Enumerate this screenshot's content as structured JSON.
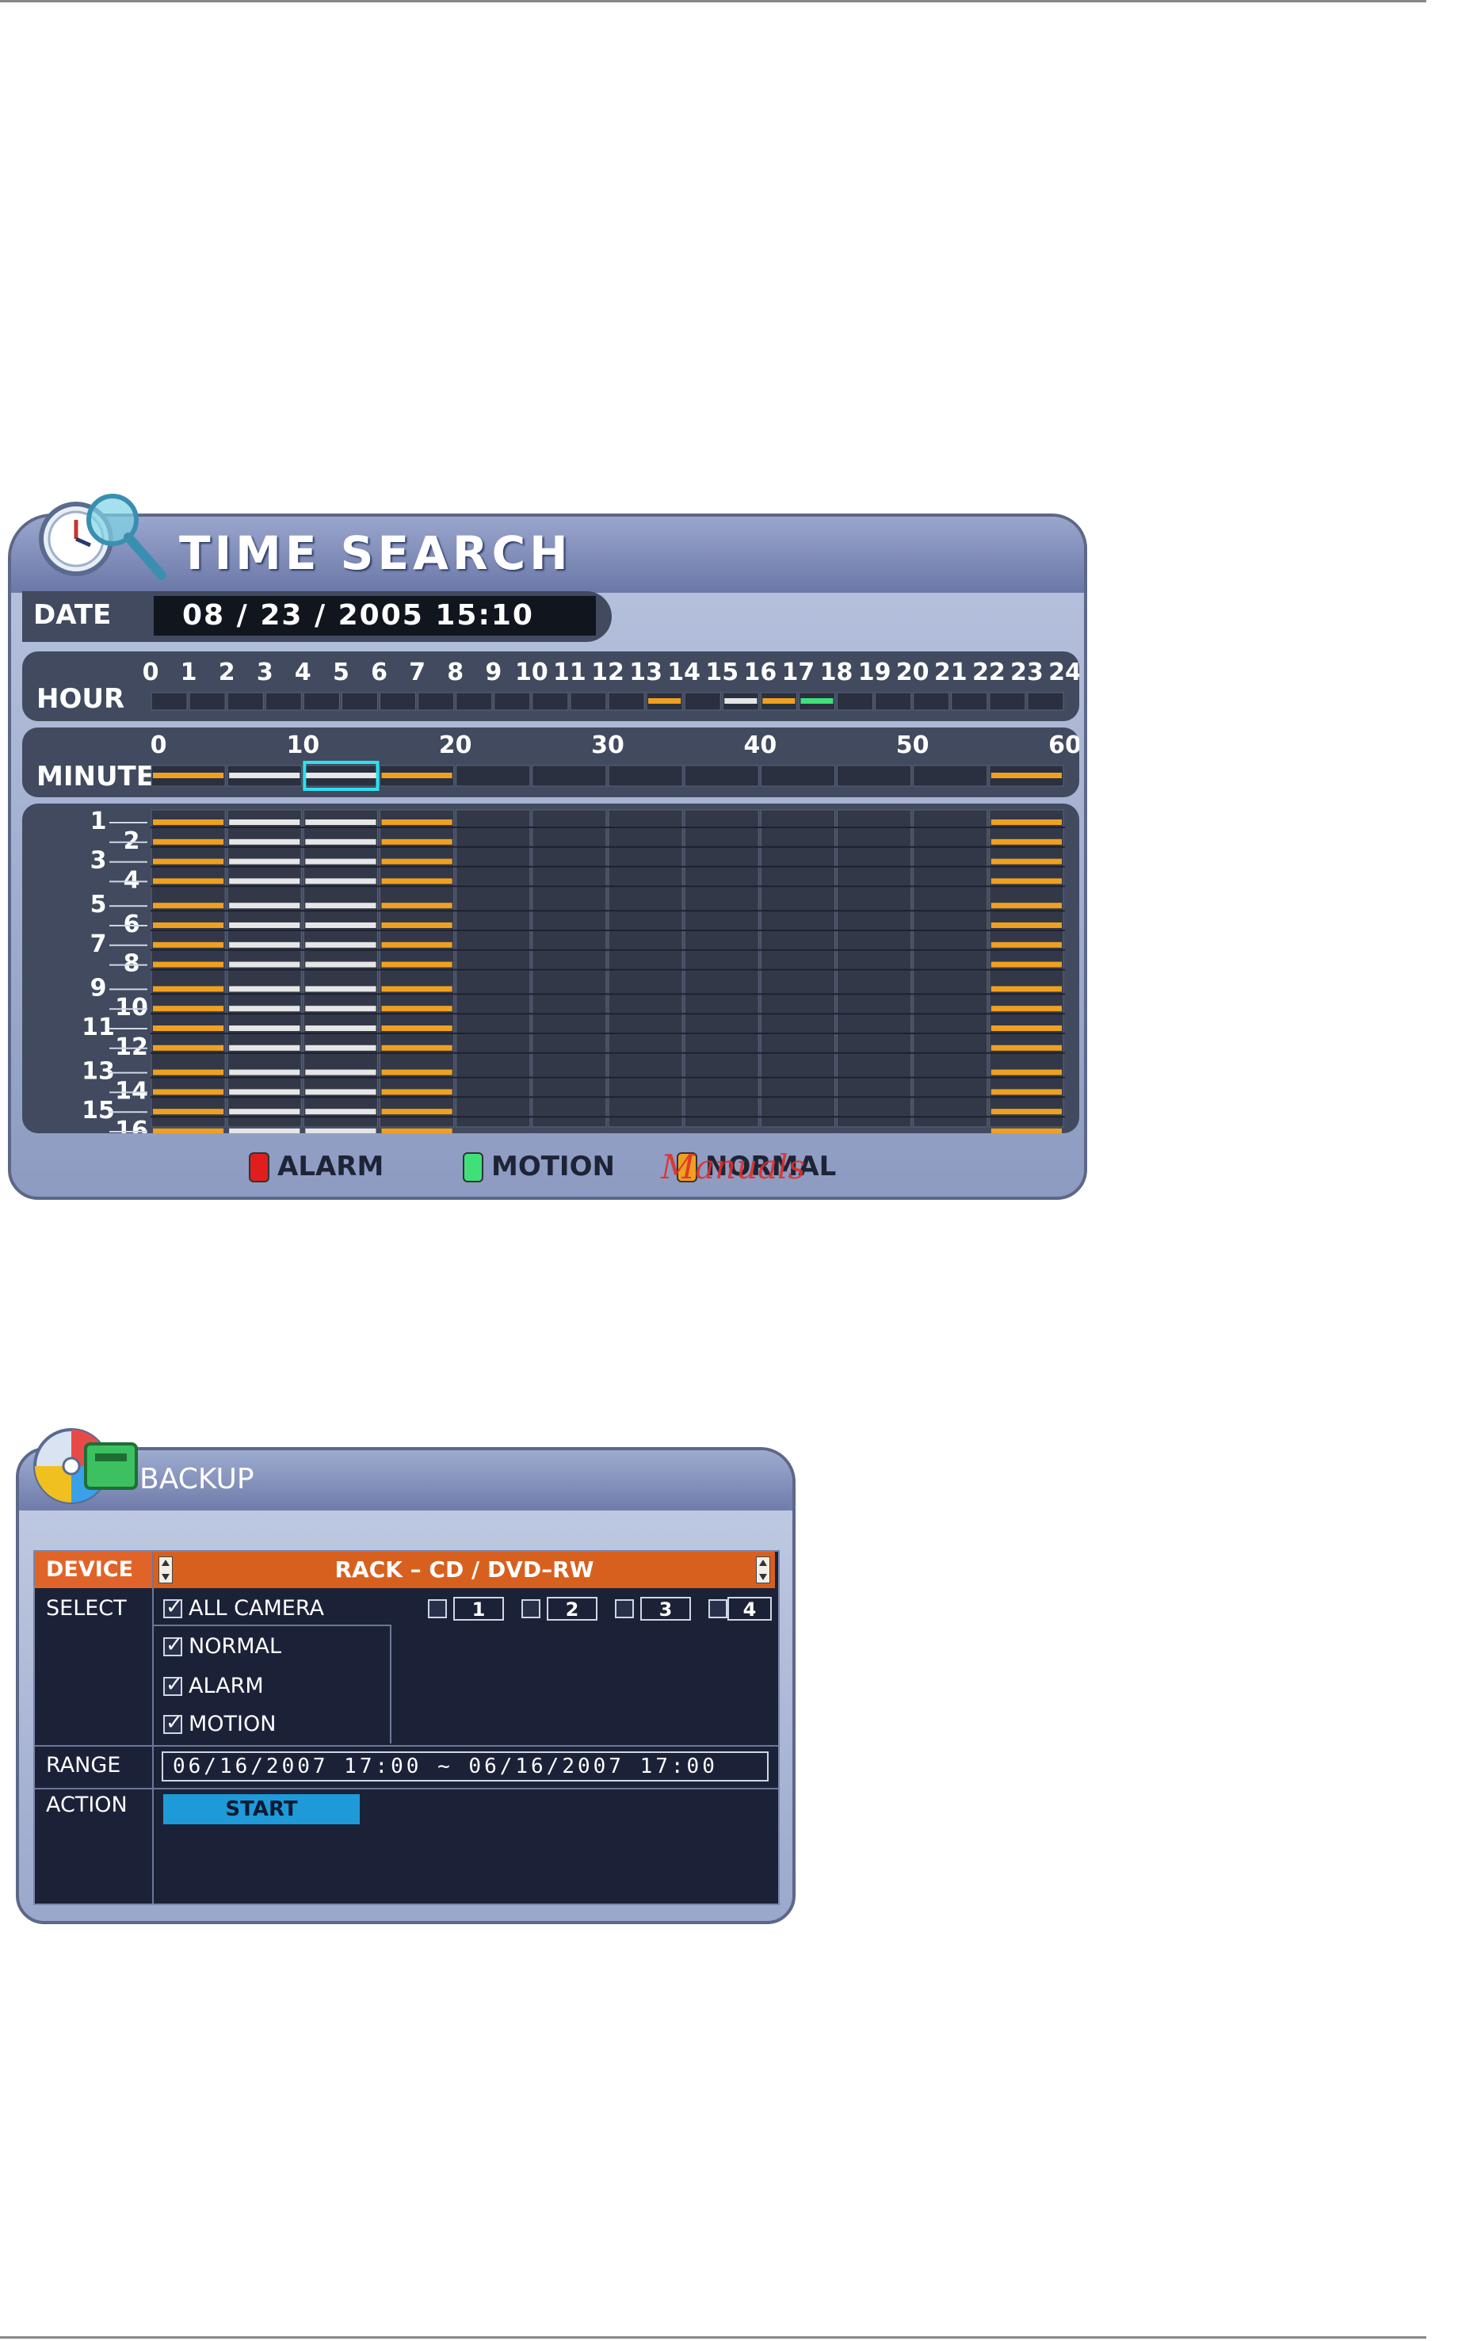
{
  "time_search": {
    "title": "TIME SEARCH",
    "date_label": "DATE",
    "date_value": "08 / 23 / 2005  15:10",
    "hour_label": "HOUR",
    "hour_ticks": [
      "0",
      "1",
      "2",
      "3",
      "4",
      "5",
      "6",
      "7",
      "8",
      "9",
      "10",
      "11",
      "12",
      "13",
      "14",
      "15",
      "16",
      "17",
      "18",
      "19",
      "20",
      "21",
      "22",
      "23",
      "24"
    ],
    "hour_bars": [
      {
        "hour": 13,
        "type": "normal"
      },
      {
        "hour": 15,
        "type": "white"
      },
      {
        "hour": 16,
        "type": "normal"
      },
      {
        "hour": 17,
        "type": "motion"
      }
    ],
    "minute_label": "MINUTE",
    "minute_ticks": [
      "0",
      "10",
      "20",
      "30",
      "40",
      "50",
      "60"
    ],
    "minute_bars": [
      {
        "segment": 0,
        "type": "normal"
      },
      {
        "segment": 1,
        "type": "white"
      },
      {
        "segment": 2,
        "type": "white"
      },
      {
        "segment": 3,
        "type": "normal"
      },
      {
        "segment": 11,
        "type": "normal"
      }
    ],
    "selected_minute_segment": 2,
    "channel_labels": [
      "1",
      "2",
      "3",
      "4",
      "5",
      "6",
      "7",
      "8",
      "9",
      "10",
      "11",
      "12",
      "13",
      "14",
      "15",
      "16"
    ],
    "channel_pattern": [
      "normal",
      "white",
      "white",
      "normal",
      "none",
      "none",
      "none",
      "none",
      "none",
      "none",
      "none",
      "normal"
    ],
    "legend": [
      {
        "label": "ALARM",
        "color": "#e01e1e"
      },
      {
        "label": "MOTION",
        "color": "#3fe07a"
      },
      {
        "label": "NORMAL",
        "color": "#f0a020"
      }
    ],
    "watermark": "Manuals",
    "colors": {
      "normal": "#f0a020",
      "white": "#e6e6e6",
      "motion": "#3fe07a",
      "alarm": "#e01e1e",
      "selected": "#2ee0f0"
    }
  },
  "backup": {
    "title": "BACKUP",
    "device_label": "DEVICE",
    "device_value": "RACK  –  CD / DVD–RW",
    "select_label": "SELECT",
    "all_camera": {
      "label": "ALL CAMERA",
      "checked": true
    },
    "cameras": [
      {
        "label": "1",
        "checked": false
      },
      {
        "label": "2",
        "checked": false
      },
      {
        "label": "3",
        "checked": false
      },
      {
        "label": "4",
        "checked": false
      }
    ],
    "types": [
      {
        "label": "NORMAL",
        "checked": true
      },
      {
        "label": "ALARM",
        "checked": true
      },
      {
        "label": "MOTION",
        "checked": true
      }
    ],
    "range_label": "RANGE",
    "range_value": "06/16/2007 17:00 ~ 06/16/2007 17:00",
    "action_label": "ACTION",
    "start_label": "START"
  }
}
